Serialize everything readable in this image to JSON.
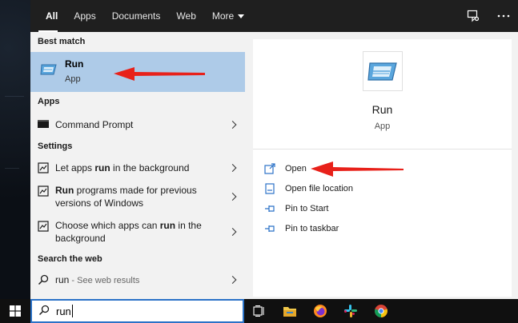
{
  "tabs": [
    {
      "label": "All",
      "active": true
    },
    {
      "label": "Apps",
      "active": false
    },
    {
      "label": "Documents",
      "active": false
    },
    {
      "label": "Web",
      "active": false
    },
    {
      "label": "More",
      "active": false
    }
  ],
  "topbar_icons": [
    "feedback-icon",
    "more-options-icon"
  ],
  "results": {
    "best_match_label": "Best match",
    "best_match": {
      "title": "Run",
      "subtitle": "App",
      "icon": "run-app-icon"
    },
    "apps_label": "Apps",
    "apps": [
      {
        "label": "Command Prompt",
        "icon": "command-prompt-icon"
      }
    ],
    "settings_label": "Settings",
    "settings": [
      {
        "before": "Let apps ",
        "bold": "run",
        "after": " in the background",
        "icon": "settings-page-icon"
      },
      {
        "before": "",
        "bold": "Run",
        "after": " programs made for previous versions of Windows",
        "icon": "settings-page-icon"
      },
      {
        "before": "Choose which apps can ",
        "bold": "run",
        "after": " in the background",
        "icon": "settings-page-icon"
      }
    ],
    "web_label": "Search the web",
    "web": {
      "query": "run",
      "suffix": " - See web results",
      "icon": "search-icon"
    }
  },
  "detail": {
    "app_name": "Run",
    "app_type": "App",
    "actions": [
      {
        "label": "Open",
        "icon": "open-icon"
      },
      {
        "label": "Open file location",
        "icon": "file-location-icon"
      },
      {
        "label": "Pin to Start",
        "icon": "pin-icon"
      },
      {
        "label": "Pin to taskbar",
        "icon": "pin-icon"
      }
    ]
  },
  "search_box": {
    "value": "run"
  },
  "taskbar_icons": [
    "task-view-icon",
    "file-explorer-icon",
    "firefox-icon",
    "slack-icon",
    "chrome-icon"
  ],
  "colors": {
    "accent": "#2b72c7",
    "highlight": "#aecbe8",
    "annotation_arrow": "#e8211a"
  }
}
